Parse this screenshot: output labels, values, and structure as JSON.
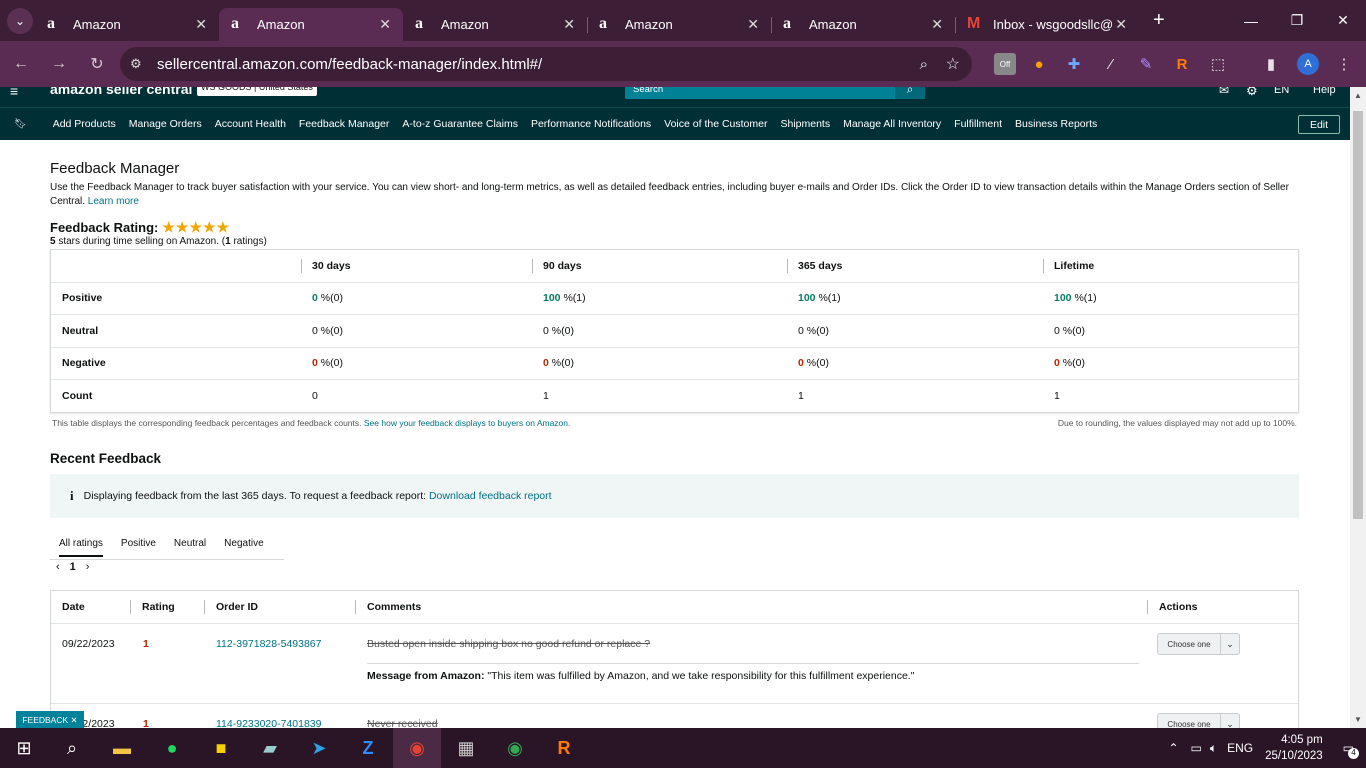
{
  "browser": {
    "tabs": [
      {
        "favicon": "a",
        "title": "Amazon",
        "active": false
      },
      {
        "favicon": "a",
        "title": "Amazon",
        "active": true
      },
      {
        "favicon": "a",
        "title": "Amazon",
        "active": false
      },
      {
        "favicon": "a",
        "title": "Amazon",
        "active": false
      },
      {
        "favicon": "a",
        "title": "Amazon",
        "active": false
      },
      {
        "favicon": "M",
        "title": "Inbox - wsgoodsllc@",
        "active": false
      }
    ],
    "url": "sellercentral.amazon.com/feedback-manager/index.html#/",
    "ext_off_label": "Off",
    "profile_initial": "A"
  },
  "amazon_header": {
    "logo": "amazon seller central",
    "store": "WS GOODS | United States",
    "search_placeholder": "Search",
    "lang": "EN",
    "help": "Help"
  },
  "nav": {
    "items": [
      "Add Products",
      "Manage Orders",
      "Account Health",
      "Feedback Manager",
      "A-to-z Guarantee Claims",
      "Performance Notifications",
      "Voice of the Customer",
      "Shipments",
      "Manage All Inventory",
      "Fulfillment",
      "Business Reports"
    ],
    "edit": "Edit"
  },
  "page": {
    "title": "Feedback Manager",
    "description": "Use the Feedback Manager to track buyer satisfaction with your service. You can view short- and long-term metrics, as well as detailed feedback entries, including buyer e-mails and Order IDs. Click the Order ID to view transaction details within the Manage Orders section of Seller Central.",
    "learn_more": "Learn more",
    "rating_label": "Feedback Rating:",
    "stars": 5,
    "rating_summary_stars": "5",
    "rating_summary_text": "stars during time selling on Amazon. (",
    "rating_summary_count": "1",
    "rating_summary_end": "ratings)"
  },
  "metrics": {
    "columns": [
      "30 days",
      "90 days",
      "365 days",
      "Lifetime"
    ],
    "rows": [
      {
        "label": "Positive",
        "cells": [
          {
            "v": "0",
            "s": "%(0)"
          },
          {
            "v": "100",
            "s": "%(1)"
          },
          {
            "v": "100",
            "s": "%(1)"
          },
          {
            "v": "100",
            "s": "%(1)"
          }
        ]
      },
      {
        "label": "Neutral",
        "cells": [
          {
            "v": "0",
            "s": "%(0)"
          },
          {
            "v": "0",
            "s": "%(0)"
          },
          {
            "v": "0",
            "s": "%(0)"
          },
          {
            "v": "0",
            "s": "%(0)"
          }
        ]
      },
      {
        "label": "Negative",
        "cells": [
          {
            "v": "0",
            "s": "%(0)"
          },
          {
            "v": "0",
            "s": "%(0)"
          },
          {
            "v": "0",
            "s": "%(0)"
          },
          {
            "v": "0",
            "s": "%(0)"
          }
        ]
      },
      {
        "label": "Count",
        "cells": [
          {
            "v": "0"
          },
          {
            "v": "1"
          },
          {
            "v": "1"
          },
          {
            "v": "1"
          }
        ]
      }
    ],
    "footnote": "This table displays the corresponding feedback percentages and feedback counts.",
    "footnote_link": "See how your feedback displays to buyers on Amazon.",
    "rounding_note": "Due to rounding, the values displayed may not add up to 100%."
  },
  "recent": {
    "title": "Recent Feedback",
    "info": "Displaying feedback from the last 365 days. To request a feedback report:",
    "info_link": "Download feedback report",
    "tabs": [
      "All ratings",
      "Positive",
      "Neutral",
      "Negative"
    ],
    "page": "1",
    "columns": [
      "Date",
      "Rating",
      "Order ID",
      "Comments",
      "Actions"
    ],
    "rows": [
      {
        "date": "09/22/2023",
        "rating": "1",
        "order": "112-3971828-5493867",
        "comment": "Busted open inside shipping box no good refund or replace ?",
        "amazon_label": "Message from Amazon:",
        "amazon_msg": "\"This item was fulfilled by Amazon, and we take responsibility for this fulfillment experience.\"",
        "action": "Choose one"
      },
      {
        "date": "09/22/2023",
        "rating": "1",
        "order": "114-9233020-7401839",
        "comment": "Never received",
        "action": "Choose one"
      }
    ],
    "badge": "FEEDBACK"
  },
  "taskbar": {
    "lang": "ENG",
    "time": "4:05 pm",
    "date": "25/10/2023",
    "notif": "4"
  }
}
